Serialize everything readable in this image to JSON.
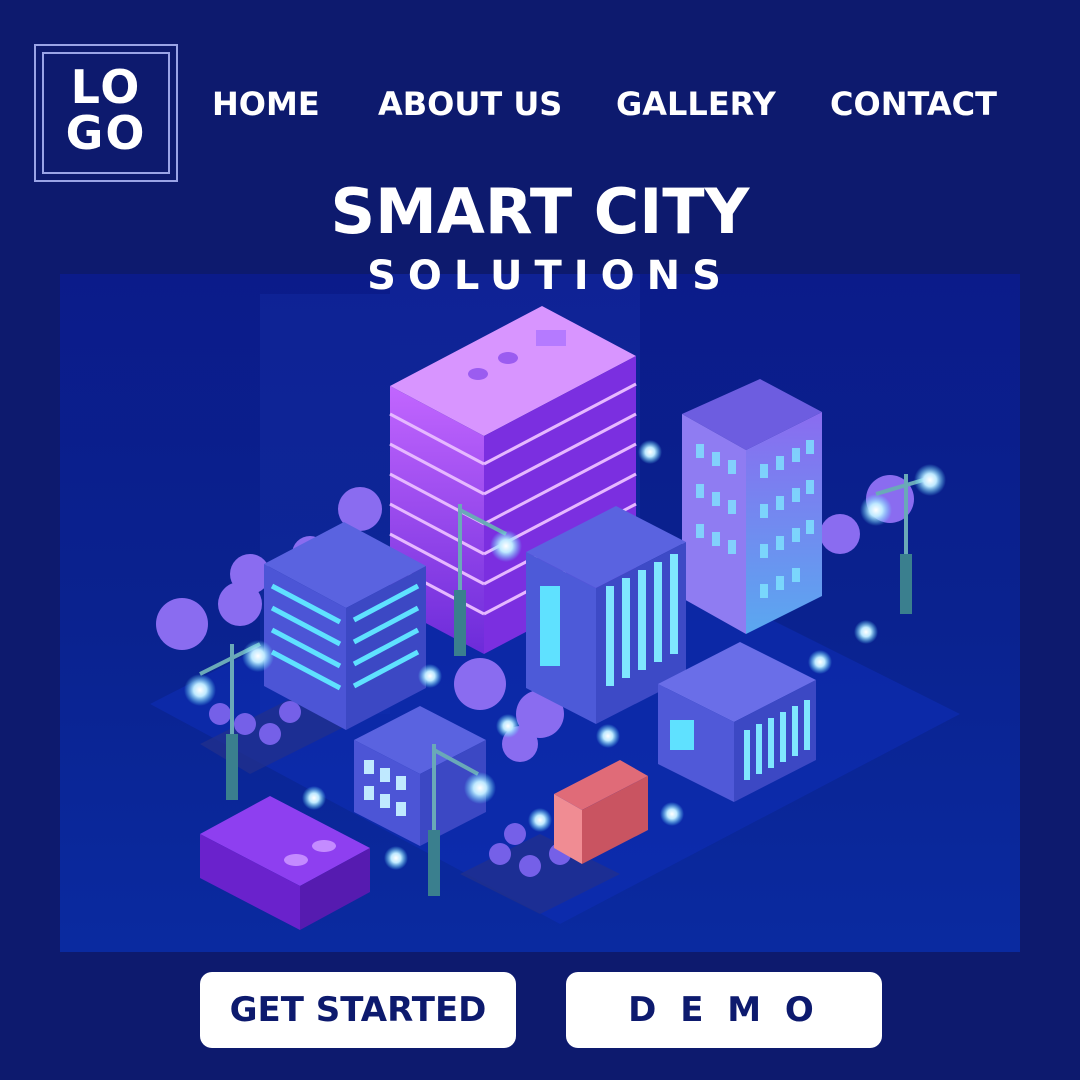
{
  "logo": {
    "line1": "LO",
    "line2": "GO"
  },
  "nav": {
    "items": [
      {
        "label": "HOME"
      },
      {
        "label": "ABOUT US"
      },
      {
        "label": "GALLERY"
      },
      {
        "label": "CONTACT"
      }
    ]
  },
  "hero": {
    "title": "SMART CITY",
    "subtitle": "SOLUTIONS",
    "illustration": "isometric-smart-city-night-icon"
  },
  "buttons": {
    "get_started": "GET STARTED",
    "demo": "D E M O"
  },
  "colors": {
    "background": "#0d1a6e",
    "accent": "#7a2cff",
    "glow": "#5fe1ff",
    "button_bg": "#ffffff",
    "button_text": "#0d1a6e"
  }
}
